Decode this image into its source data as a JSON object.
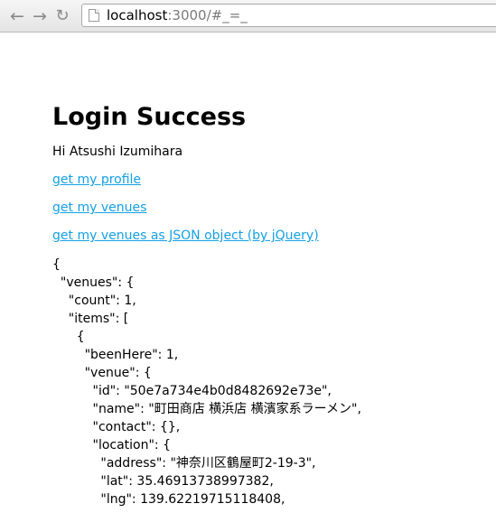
{
  "browser": {
    "url_host": "localhost",
    "url_rest": ":3000/#_=_"
  },
  "page": {
    "title": "Login Success",
    "greeting": "Hi Atsushi Izumihara",
    "links": [
      "get my profile",
      "get my venues",
      "get my venues as JSON object (by jQuery)"
    ],
    "json_output": "{\n  \"venues\": {\n    \"count\": 1,\n    \"items\": [\n      {\n        \"beenHere\": 1,\n        \"venue\": {\n          \"id\": \"50e7a734e4b0d8482692e73e\",\n          \"name\": \"町田商店 横浜店 横濱家系ラーメン\",\n          \"contact\": {},\n          \"location\": {\n            \"address\": \"神奈川区鶴屋町2-19-3\",\n            \"lat\": 35.46913738997382,\n            \"lng\": 139.62219715118408,"
  }
}
